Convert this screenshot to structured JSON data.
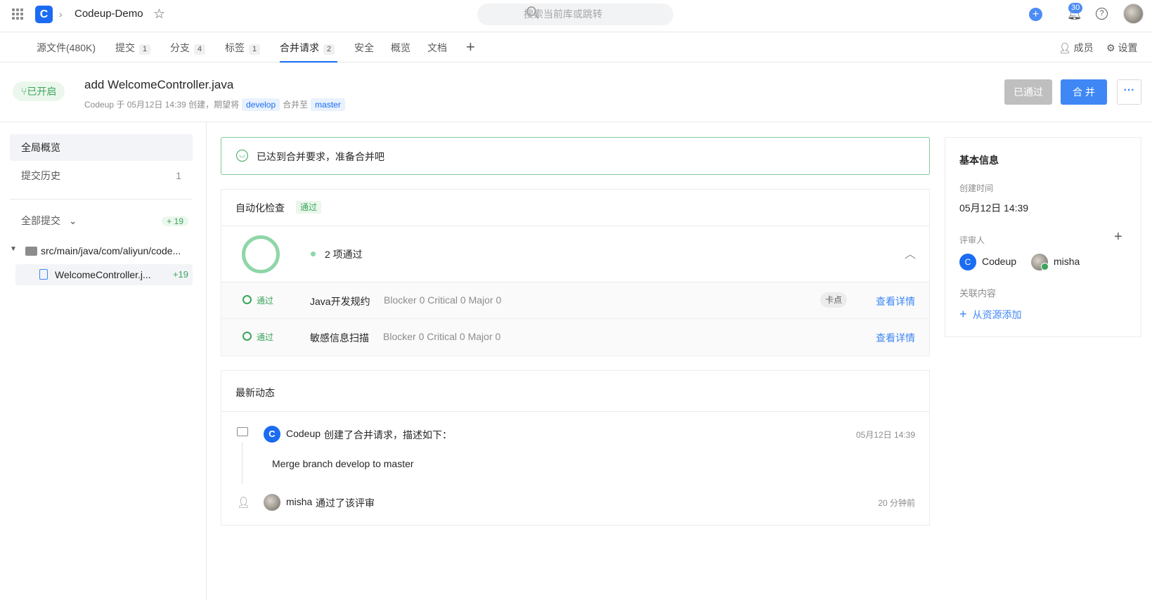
{
  "topbar": {
    "repo_name": "Codeup-Demo",
    "search_placeholder": "搜索当前库或跳转",
    "notification_count": "30"
  },
  "tabs": {
    "items": [
      {
        "label": "源文件(480K)",
        "count": ""
      },
      {
        "label": "提交",
        "count": "1"
      },
      {
        "label": "分支",
        "count": "4"
      },
      {
        "label": "标签",
        "count": "1"
      },
      {
        "label": "合并请求",
        "count": "2"
      },
      {
        "label": "安全",
        "count": ""
      },
      {
        "label": "概览",
        "count": ""
      },
      {
        "label": "文档",
        "count": ""
      }
    ],
    "members": "成员",
    "settings": "设置"
  },
  "mr": {
    "state": "已开启",
    "title": "add WelcomeController.java",
    "meta_prefix": "Codeup 于 05月12日 14:39 创建，期望将",
    "source_branch": "develop",
    "meta_mid": "合并至",
    "target_branch": "master",
    "approved_button": "已通过",
    "merge_button": "合 并"
  },
  "sidebar": {
    "overview": "全局概览",
    "history": "提交历史",
    "history_count": "1",
    "all_commits": "全部提交",
    "all_commits_badge": "+ 19",
    "folder": "src/main/java/com/aliyun/code...",
    "file": "WelcomeController.j...",
    "file_badge": "+19"
  },
  "banner": {
    "text": "已达到合并要求，准备合并吧"
  },
  "checks": {
    "title": "自动化检查",
    "status": "通过",
    "summary": "2 项通过",
    "rows": [
      {
        "status": "通过",
        "name": "Java开发规约",
        "result": "Blocker 0 Critical 0 Major 0",
        "tag": "卡点",
        "link": "查看详情"
      },
      {
        "status": "通过",
        "name": "敏感信息扫描",
        "result": "Blocker 0 Critical 0 Major 0",
        "tag": "",
        "link": "查看详情"
      }
    ]
  },
  "activity": {
    "title": "最新动态",
    "events": [
      {
        "user": "Codeup",
        "action": "创建了合并请求，描述如下：",
        "time": "05月12日 14:39",
        "body": "Merge branch develop to master"
      },
      {
        "user": "misha",
        "action": "通过了该评审",
        "time": "20 分钟前",
        "body": ""
      }
    ]
  },
  "info": {
    "title": "基本信息",
    "created_label": "创建时间",
    "created_value": "05月12日 14:39",
    "reviewers_label": "评审人",
    "reviewers": [
      "Codeup",
      "misha"
    ],
    "related_label": "关联内容",
    "add_related": "从资源添加"
  },
  "colors": {
    "primary": "#3f87f5",
    "success": "#3aa55c",
    "border": "#ececec"
  }
}
